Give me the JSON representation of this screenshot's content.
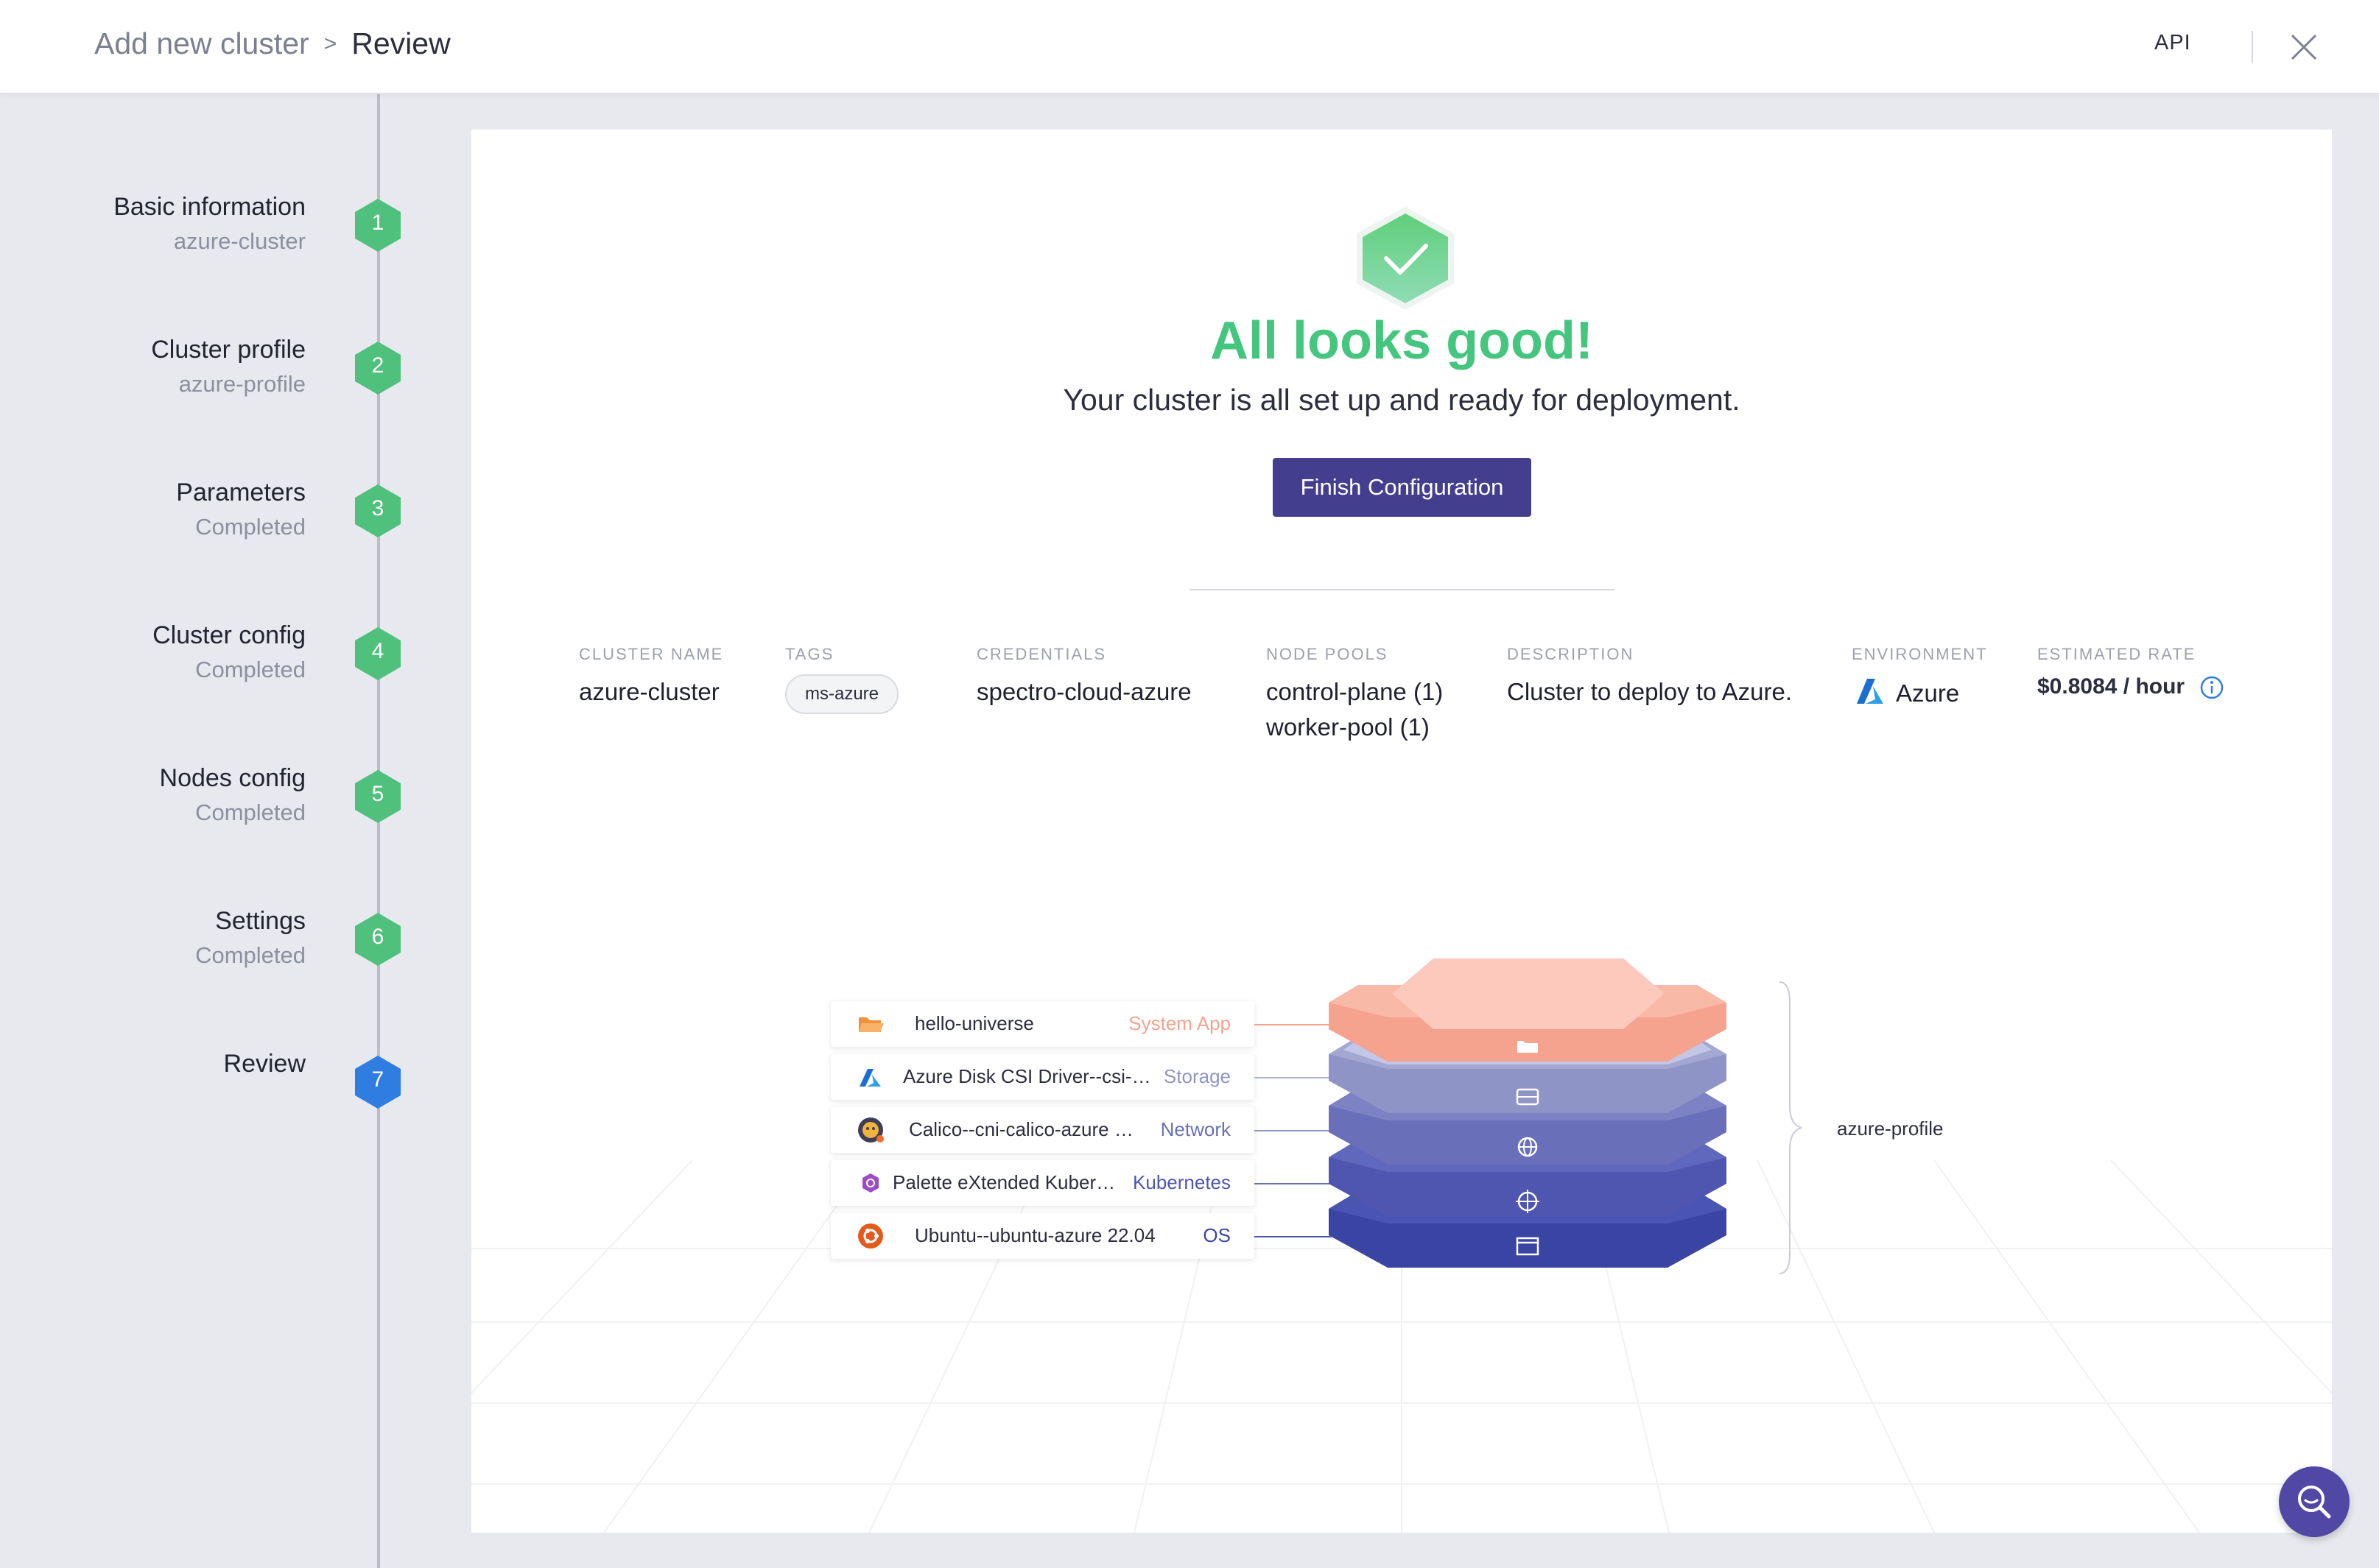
{
  "header": {
    "breadcrumb_root": "Add new cluster",
    "breadcrumb_separator": ">",
    "breadcrumb_current": "Review",
    "api_label": "API",
    "close_icon": "close-icon"
  },
  "steps": [
    {
      "number": "1",
      "title": "Basic information",
      "subtitle": "azure-cluster",
      "state": "done"
    },
    {
      "number": "2",
      "title": "Cluster profile",
      "subtitle": "azure-profile",
      "state": "done"
    },
    {
      "number": "3",
      "title": "Parameters",
      "subtitle": "Completed",
      "state": "done"
    },
    {
      "number": "4",
      "title": "Cluster config",
      "subtitle": "Completed",
      "state": "done"
    },
    {
      "number": "5",
      "title": "Nodes config",
      "subtitle": "Completed",
      "state": "done"
    },
    {
      "number": "6",
      "title": "Settings",
      "subtitle": "Completed",
      "state": "done"
    },
    {
      "number": "7",
      "title": "Review",
      "subtitle": "",
      "state": "active"
    }
  ],
  "review": {
    "success_icon": "check-icon",
    "headline": "All looks good!",
    "subline": "Your cluster is all set up and ready for deployment.",
    "finish_button": "Finish Configuration"
  },
  "summary": {
    "cluster_name": {
      "label": "CLUSTER NAME",
      "value": "azure-cluster"
    },
    "tags": {
      "label": "TAGS",
      "values": [
        "ms-azure"
      ]
    },
    "credentials": {
      "label": "CREDENTIALS",
      "value": "spectro-cloud-azure"
    },
    "node_pools": {
      "label": "NODE POOLS",
      "values": [
        "control-plane (1)",
        "worker-pool (1)"
      ]
    },
    "description": {
      "label": "DESCRIPTION",
      "value": "Cluster to deploy to Azure."
    },
    "environment": {
      "label": "ENVIRONMENT",
      "value": "Azure",
      "icon": "azure-logo-icon"
    },
    "estimated_rate": {
      "label": "ESTIMATED RATE",
      "value": "$0.8084 / hour",
      "icon": "info-icon"
    }
  },
  "profile": {
    "name": "azure-profile",
    "layers": [
      {
        "name": "hello-universe",
        "type": "System App",
        "icon": "folder-icon",
        "color": "#f5a38e"
      },
      {
        "name": "Azure Disk CSI Driver--csi-…",
        "type": "Storage",
        "icon": "azure-icon",
        "color": "#8f94c6"
      },
      {
        "name": "Calico--cni-calico-azure …",
        "type": "Network",
        "icon": "calico-icon",
        "color": "#6a6fb9"
      },
      {
        "name": "Palette eXtended Kuber…",
        "type": "Kubernetes",
        "icon": "palette-icon",
        "color": "#4f56b0"
      },
      {
        "name": "Ubuntu--ubuntu-azure 22.04",
        "type": "OS",
        "icon": "ubuntu-icon",
        "color": "#3a44a3"
      }
    ]
  },
  "colors": {
    "accent_primary": "#443e8e",
    "success": "#45c67e",
    "step_done": "#4fc17c",
    "step_active": "#2f7de1"
  },
  "help_fab_icon": "search-help-icon"
}
